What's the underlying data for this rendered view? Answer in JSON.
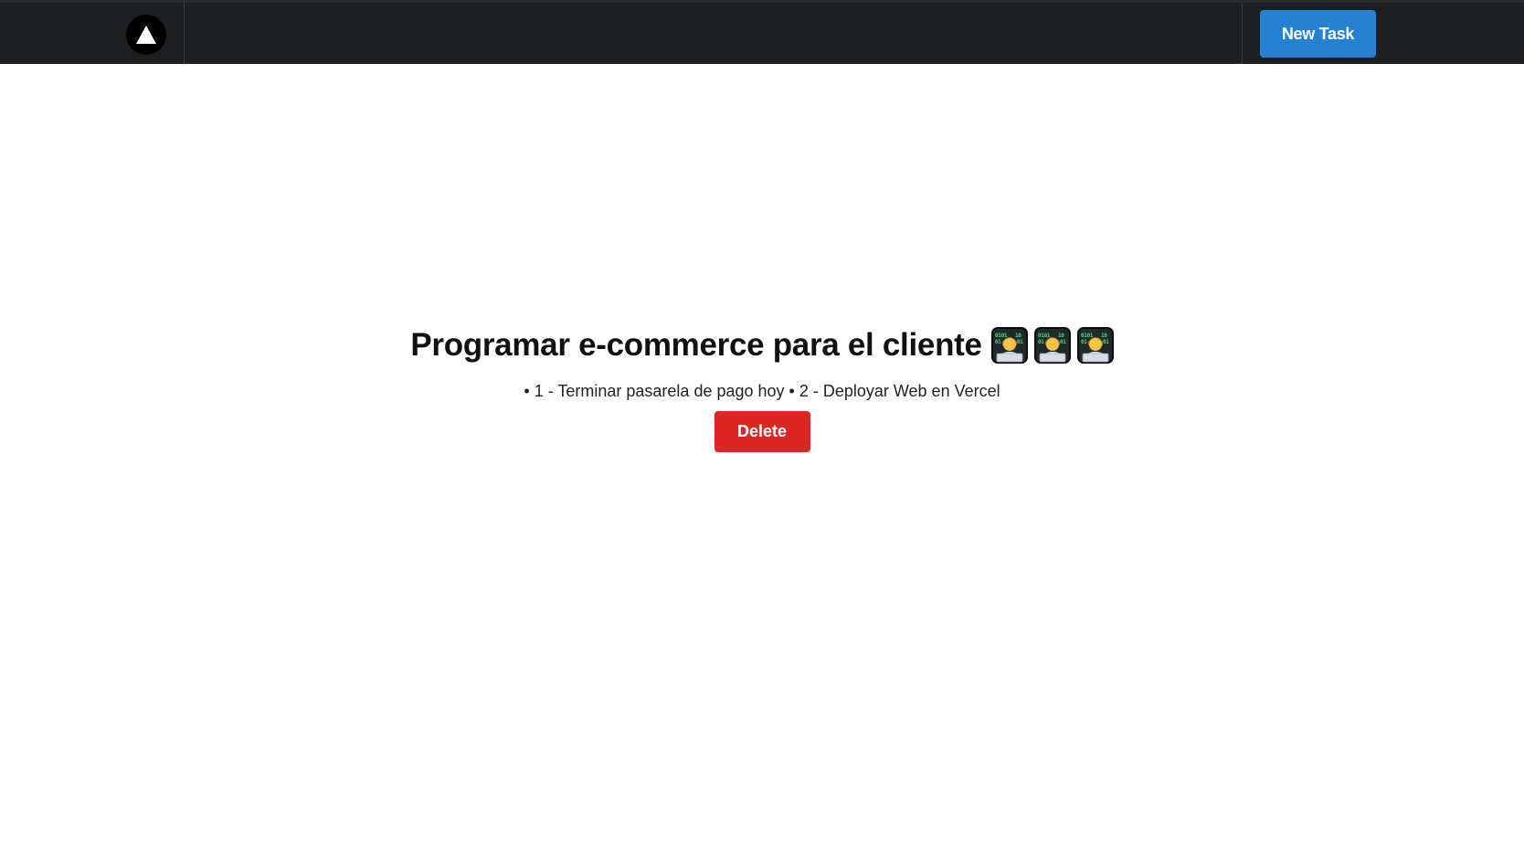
{
  "header": {
    "logo_icon": "triangle-logo-icon",
    "new_task_label": "New Task",
    "new_task_color": "#2680d4"
  },
  "task": {
    "title": "Programar e-commerce para el cliente",
    "title_emoji_icon": "technologist-emoji-icon",
    "title_emoji_count": 3,
    "description": "• 1 - Terminar pasarela de pago hoy • 2 - Deployar Web en Vercel",
    "delete_label": "Delete",
    "delete_color": "#dc2626"
  }
}
